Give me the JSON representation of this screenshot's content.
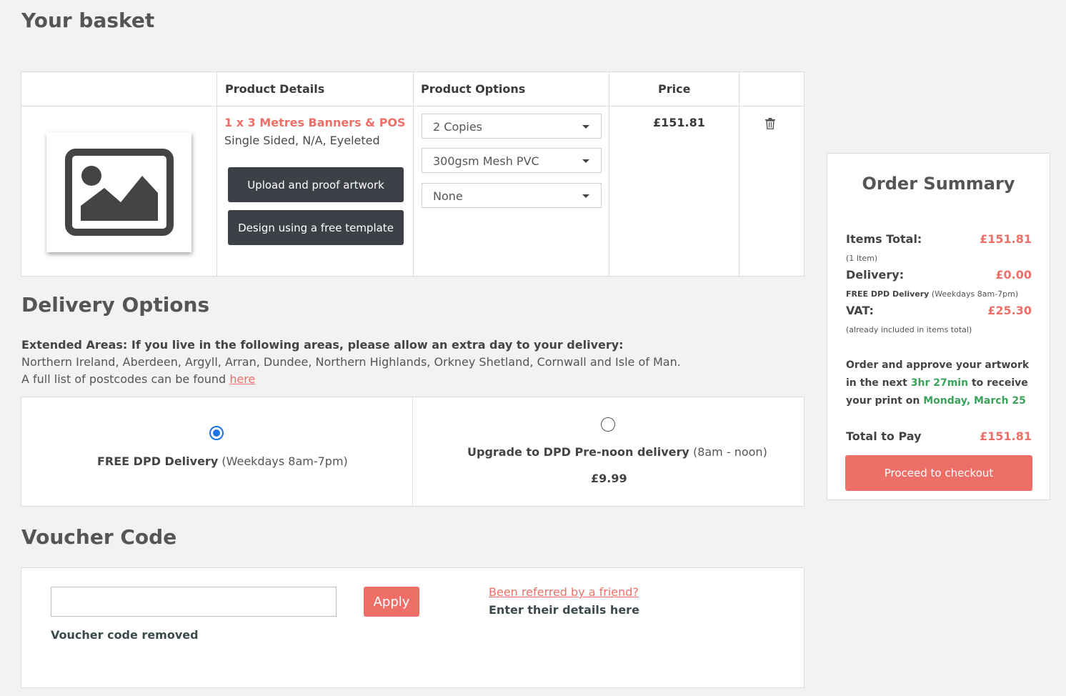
{
  "page": {
    "title": "Your basket"
  },
  "basket": {
    "headers": {
      "details": "Product Details",
      "options": "Product Options",
      "price": "Price"
    },
    "item": {
      "image_icon": "image-placeholder-icon",
      "name": "1 x 3 Metres Banners & POS",
      "spec": "Single Sided, N/A, Eyeleted",
      "upload_label": "Upload and proof artwork",
      "template_label": "Design using a free template",
      "options": [
        "2 Copies",
        "300gsm Mesh PVC",
        "None"
      ],
      "price": "£151.81",
      "delete_icon": "trash-icon"
    }
  },
  "delivery": {
    "title": "Delivery Options",
    "extended_heading": "Extended Areas: If you live in the following areas, please allow an extra day to your delivery:",
    "extended_areas": "Northern Ireland, Aberdeen, Argyll, Arran, Dundee, Northern Highlands, Orkney Shetland, Cornwall and Isle of Man.",
    "postcodes_text": "A full list of postcodes can be found",
    "postcodes_link": "here",
    "options": [
      {
        "name": "FREE DPD Delivery",
        "detail": "(Weekdays 8am-7pm)",
        "price": "",
        "selected": true
      },
      {
        "name": "Upgrade to DPD Pre-noon delivery",
        "detail": "(8am - noon)",
        "price": "£9.99",
        "selected": false
      }
    ]
  },
  "voucher": {
    "title": "Voucher Code",
    "input_value": "",
    "apply_label": "Apply",
    "message": "Voucher code removed",
    "referral_link": "Been referred by a friend?",
    "referral_sub": "Enter their details here"
  },
  "summary": {
    "title": "Order Summary",
    "items_total_label": "Items Total:",
    "items_total_value": "£151.81",
    "items_count": "(1 Item)",
    "delivery_label": "Delivery:",
    "delivery_value": "£0.00",
    "delivery_note_bold": "FREE DPD Delivery",
    "delivery_note": "(Weekdays 8am-7pm)",
    "vat_label": "VAT:",
    "vat_value": "£25.30",
    "vat_note": "(already included in items total)",
    "msg_part1": "Order and approve your artwork in the next",
    "msg_time": "3hr 27min",
    "msg_part2": "to receive your print on",
    "msg_date": "Monday, March 25",
    "total_label": "Total to Pay",
    "total_value": "£151.81",
    "checkout_label": "Proceed to checkout"
  },
  "colors": {
    "accent": "#ee6f68",
    "dark_button": "#3d4147",
    "green": "#3aa35a",
    "radio_blue": "#1a73e8"
  }
}
